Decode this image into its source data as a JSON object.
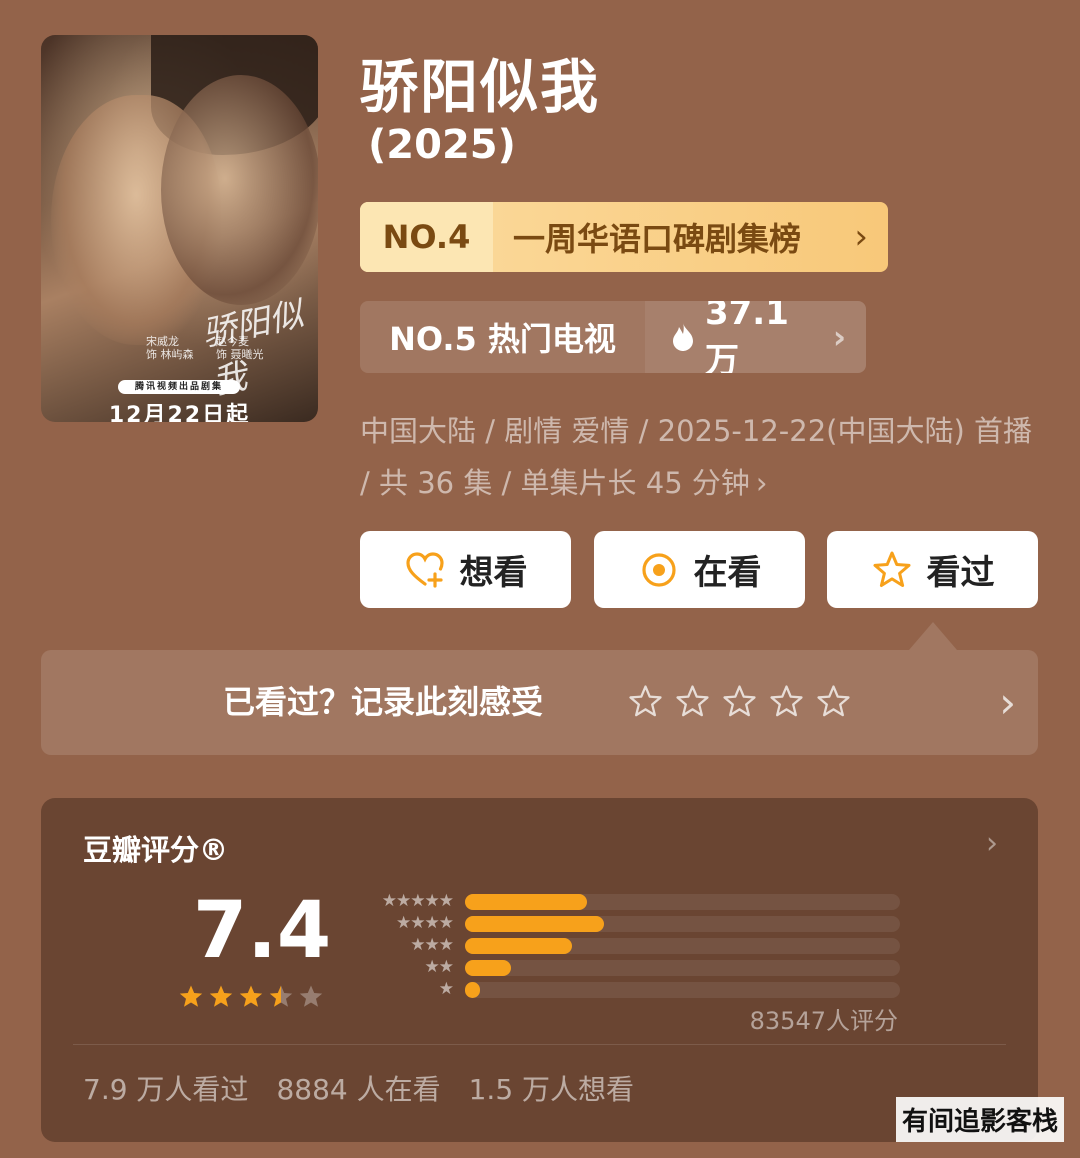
{
  "poster": {
    "logo_text": "骄阳似我",
    "cast": [
      {
        "name": "宋威龙",
        "role": "饰 林屿森"
      },
      {
        "name": "赵今麦",
        "role": "饰 聂曦光"
      }
    ],
    "studio": "腾讯视频出品剧集",
    "release": "12月22日起"
  },
  "title": "骄阳似我",
  "year": "(2025)",
  "rank_badge": {
    "number": "NO.4",
    "label": "一周华语口碑剧集榜",
    "chevron": "›"
  },
  "hot_badge": {
    "number_label": "NO.5 热门电视",
    "heat": "37.1万",
    "chevron": "›"
  },
  "meta": {
    "line": "中国大陆 / 剧情 爱情 / 2025-12-22(中国大陆) 首播 / 共 36 集 / 单集片长 45 分钟",
    "chevron": "›"
  },
  "actions": {
    "want": "想看",
    "watching": "在看",
    "watched": "看过"
  },
  "record": {
    "prompt": "已看过？记录此刻感受",
    "chevron": "›"
  },
  "rating": {
    "title": "豆瓣评分®",
    "chevron": "›",
    "score": "7.4",
    "stars": 3.5,
    "distribution": [
      {
        "stars": "★★★★★",
        "fraction": 0.28
      },
      {
        "stars": "★★★★",
        "fraction": 0.32
      },
      {
        "stars": "★★★",
        "fraction": 0.245
      },
      {
        "stars": "★★",
        "fraction": 0.105
      },
      {
        "stars": "★",
        "fraction": 0.035
      }
    ],
    "count": "83547人评分",
    "stats": [
      "7.9 万人看过",
      "8884 人在看",
      "1.5 万人想看"
    ]
  },
  "watermark": "有间追影客栈",
  "colors": {
    "background": "#93634a",
    "card": "#6a4532",
    "rank_badge": "#f8c879",
    "star": "#f7a11b"
  }
}
